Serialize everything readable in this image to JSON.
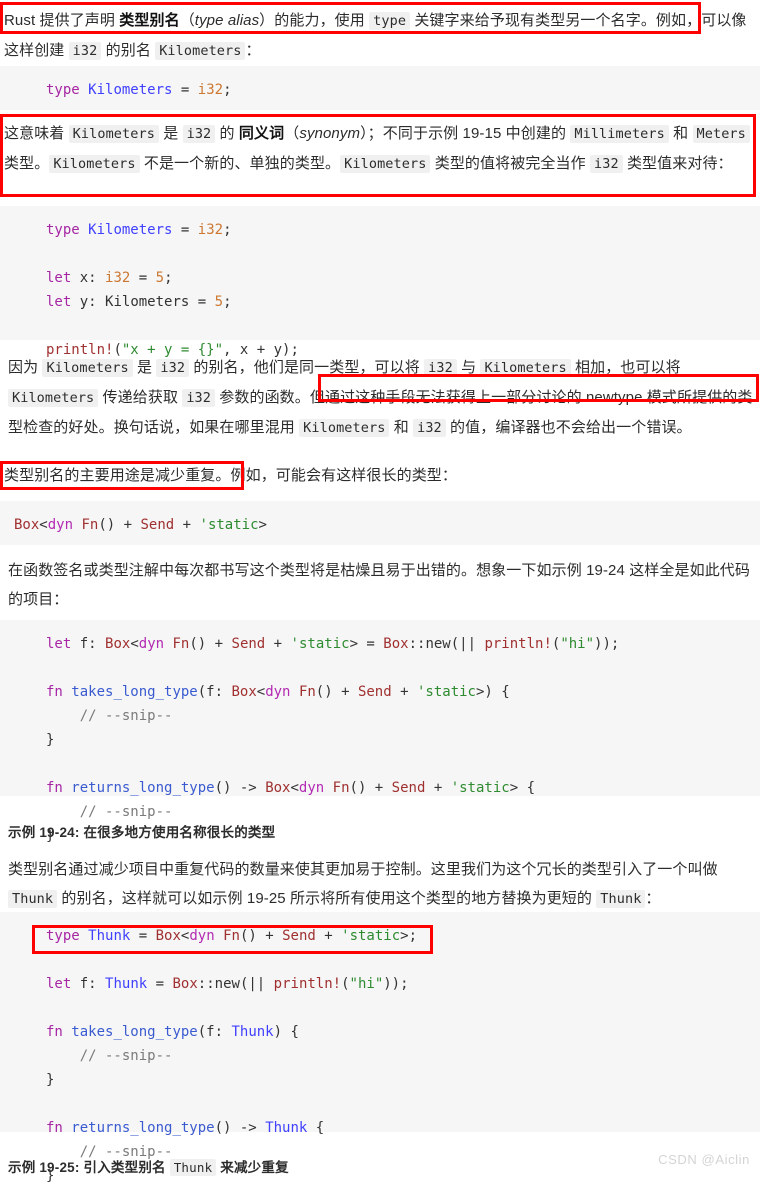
{
  "page": {
    "watermark": "CSDN @Aiclin"
  },
  "paragraphs": {
    "p1": {
      "seg1": "Rust 提供了声明 ",
      "bold1": "类型别名",
      "seg2": "（",
      "ital1": "type alias",
      "seg3": "）的能力，使用 ",
      "code1": "type",
      "seg4": " 关键字来给予现有类型另一个名字。例如，可以像这样创建 ",
      "code2": "i32",
      "seg5": " 的别名 ",
      "code3": "Kilometers",
      "seg6": "："
    },
    "p2": {
      "seg1": "这意味着 ",
      "code1": "Kilometers",
      "seg2": " 是 ",
      "code2": "i32",
      "seg3": " 的 ",
      "bold1": "同义词",
      "seg4": "（",
      "ital1": "synonym",
      "seg5": "）；不同于示例 19-15 中创建的 ",
      "code3": "Millimeters",
      "seg6": " 和 ",
      "code4": "Meters",
      "seg7": " 类型。",
      "code5": "Kilometers",
      "seg8": " 不是一个新的、单独的类型。",
      "code6": "Kilometers",
      "seg9": " 类型的值将被完全当作 ",
      "code7": "i32",
      "seg10": " 类型值来对待："
    },
    "p3": {
      "seg1": "因为 ",
      "code1": "Kilometers",
      "seg2": " 是 ",
      "code2": "i32",
      "seg3": " 的别名，他们是同一类型，可以将 ",
      "code3": "i32",
      "seg4": " 与 ",
      "code4": "Kilometers",
      "seg5": " 相加，也可以将 ",
      "code5": "Kilometers",
      "seg6": " 传递给获取 ",
      "code6": "i32",
      "seg7": " 参数的函数。但通过这种手段无法获得上一部分讨论的 newtype 模式所提供的类型检查的好处。换句话说，如果在哪里混用 ",
      "code7": "Kilometers",
      "seg8": " 和 ",
      "code8": "i32",
      "seg9": " 的值，编译器也不会给出一个错误。"
    },
    "p4": {
      "seg1": "类型别名的主要用途是减少重复。例如，可能会有这样很长的类型："
    },
    "p5": {
      "seg1": "在函数签名或类型注解中每次都书写这个类型将是枯燥且易于出错的。想象一下如示例 19-24 这样全是如此代码的项目："
    },
    "p6": {
      "seg1": "类型别名通过减少项目中重复代码的数量来使其更加易于控制。这里我们为这个冗长的类型引入了一个叫做 ",
      "code1": "Thunk",
      "seg2": " 的别名，这样就可以如示例 19-25 所示将所有使用这个类型的地方替换为更短的 ",
      "code2": "Thunk",
      "seg3": "："
    }
  },
  "code_blocks": {
    "cb1": {
      "lines": [
        "type Kilometers = i32;"
      ]
    },
    "cb2": {
      "lines": [
        "type Kilometers = i32;",
        "",
        "let x: i32 = 5;",
        "let y: Kilometers = 5;",
        "",
        "println!(\"x + y = {}\", x + y);"
      ]
    },
    "cb3": {
      "lines": [
        "Box<dyn Fn() + Send + 'static>"
      ]
    },
    "cb4": {
      "lines": [
        "let f: Box<dyn Fn() + Send + 'static> = Box::new(|| println!(\"hi\"));",
        "",
        "fn takes_long_type(f: Box<dyn Fn() + Send + 'static>) {",
        "    // --snip--",
        "}",
        "",
        "fn returns_long_type() -> Box<dyn Fn() + Send + 'static> {",
        "    // --snip--",
        "}"
      ]
    },
    "cb5": {
      "lines": [
        "type Thunk = Box<dyn Fn() + Send + 'static>;",
        "",
        "let f: Thunk = Box::new(|| println!(\"hi\"));",
        "",
        "fn takes_long_type(f: Thunk) {",
        "    // --snip--",
        "}",
        "",
        "fn returns_long_type() -> Thunk {",
        "    // --snip--",
        "}"
      ]
    }
  },
  "captions": {
    "cap1": "示例 19-24: 在很多地方使用名称很长的类型",
    "cap2_pre": "示例 19-25: 引入类型别名 ",
    "cap2_code": "Thunk",
    "cap2_post": " 来减少重复"
  },
  "annotations": {
    "boxes": [
      {
        "name": "redbox-type-alias-intro",
        "color": "#ff0000"
      },
      {
        "name": "redbox-synonym-paragraph",
        "color": "#ff0000"
      },
      {
        "name": "redbox-newtype-note",
        "color": "#ff0000"
      },
      {
        "name": "redbox-main-purpose",
        "color": "#ff0000"
      },
      {
        "name": "redbox-thunk-declaration",
        "color": "#ff0000"
      }
    ]
  }
}
